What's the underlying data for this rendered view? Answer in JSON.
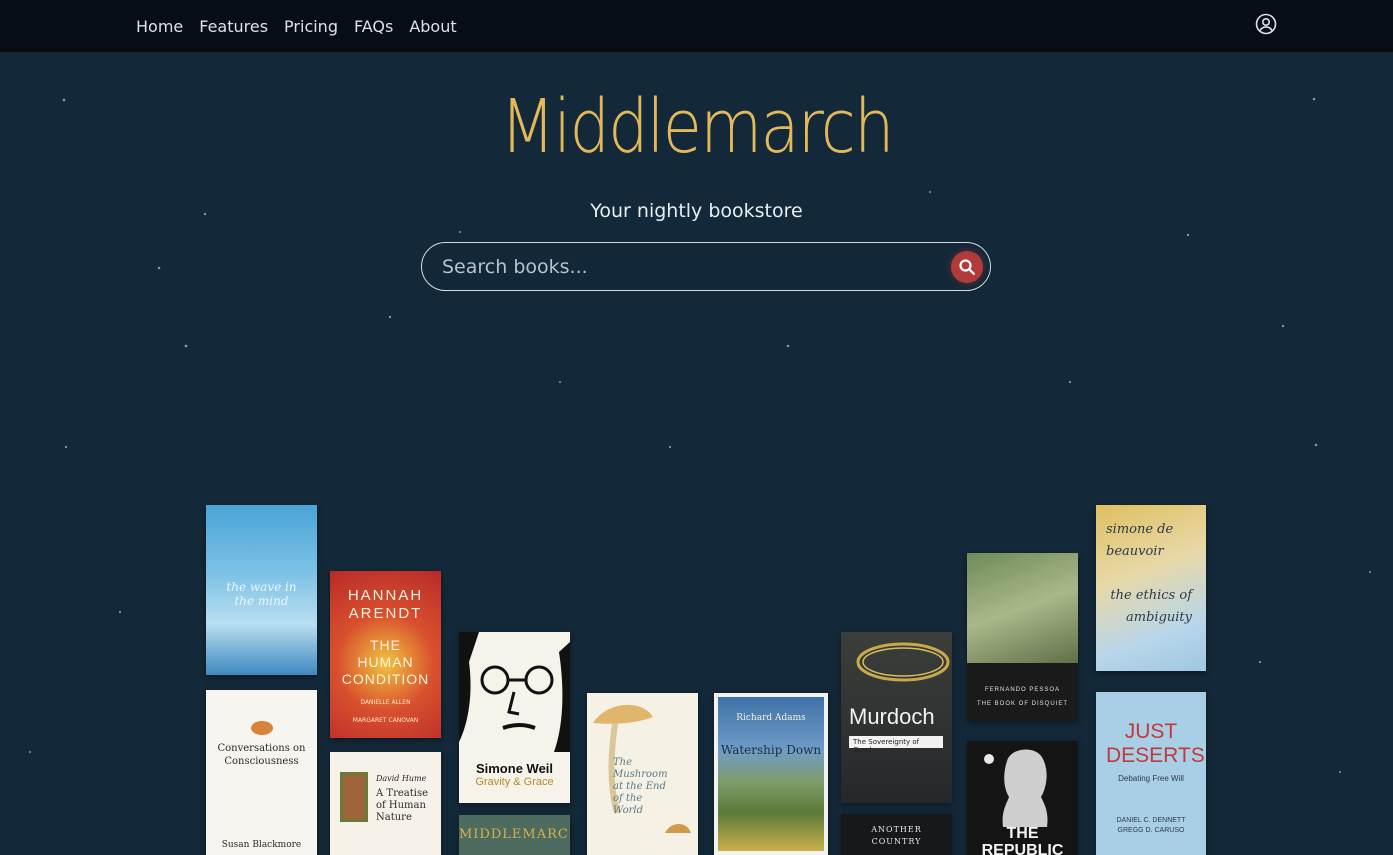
{
  "nav": {
    "items": [
      "Home",
      "Features",
      "Pricing",
      "FAQs",
      "About"
    ]
  },
  "icons": {
    "user": "user-circle-icon",
    "search": "search-icon"
  },
  "colors": {
    "background": "#132838",
    "topbar": "#040e14",
    "logo": "#e2b85a",
    "search_button": "#b23a3a"
  },
  "hero": {
    "logo": "Middlemarch",
    "tagline": "Your nightly bookstore"
  },
  "search": {
    "placeholder": "Search books..."
  },
  "books": {
    "wave": {
      "title": "the wave in the mind"
    },
    "arendt": {
      "author": "HANNAH ARENDT",
      "title": "THE HUMAN CONDITION",
      "extra": "DANIELLE ALLEN",
      "extra2": "MARGARET CANOVAN"
    },
    "conversations": {
      "title": "Conversations on Consciousness",
      "author": "Susan Blackmore"
    },
    "hume": {
      "author": "David Hume",
      "title": "A Treatise of Human Nature"
    },
    "weil": {
      "author": "Simone Weil",
      "title": "Gravity & Grace"
    },
    "middlemarch": {
      "title": "MIDDLEMARCH"
    },
    "mushroom": {
      "title": "The Mushroom at the End of the World"
    },
    "watership": {
      "author": "Richard Adams",
      "title": "Watership Down"
    },
    "murdoch": {
      "author": "Murdoch",
      "title": "The Sovereignty of Good"
    },
    "another": {
      "title": "ANOTHER COUNTRY"
    },
    "pessoa": {
      "author": "FERNANDO PESSOA",
      "title": "THE BOOK OF DISQUIET"
    },
    "republic": {
      "title": "THE REPUBLIC"
    },
    "beauvoir": {
      "author": "simone de beauvoir",
      "title": "the ethics of ambiguity"
    },
    "deserts": {
      "title": "JUST DESERTS",
      "subtitle": "Debating Free Will",
      "authors": "DANIEL C. DENNETT GREGG D. CARUSO"
    }
  }
}
